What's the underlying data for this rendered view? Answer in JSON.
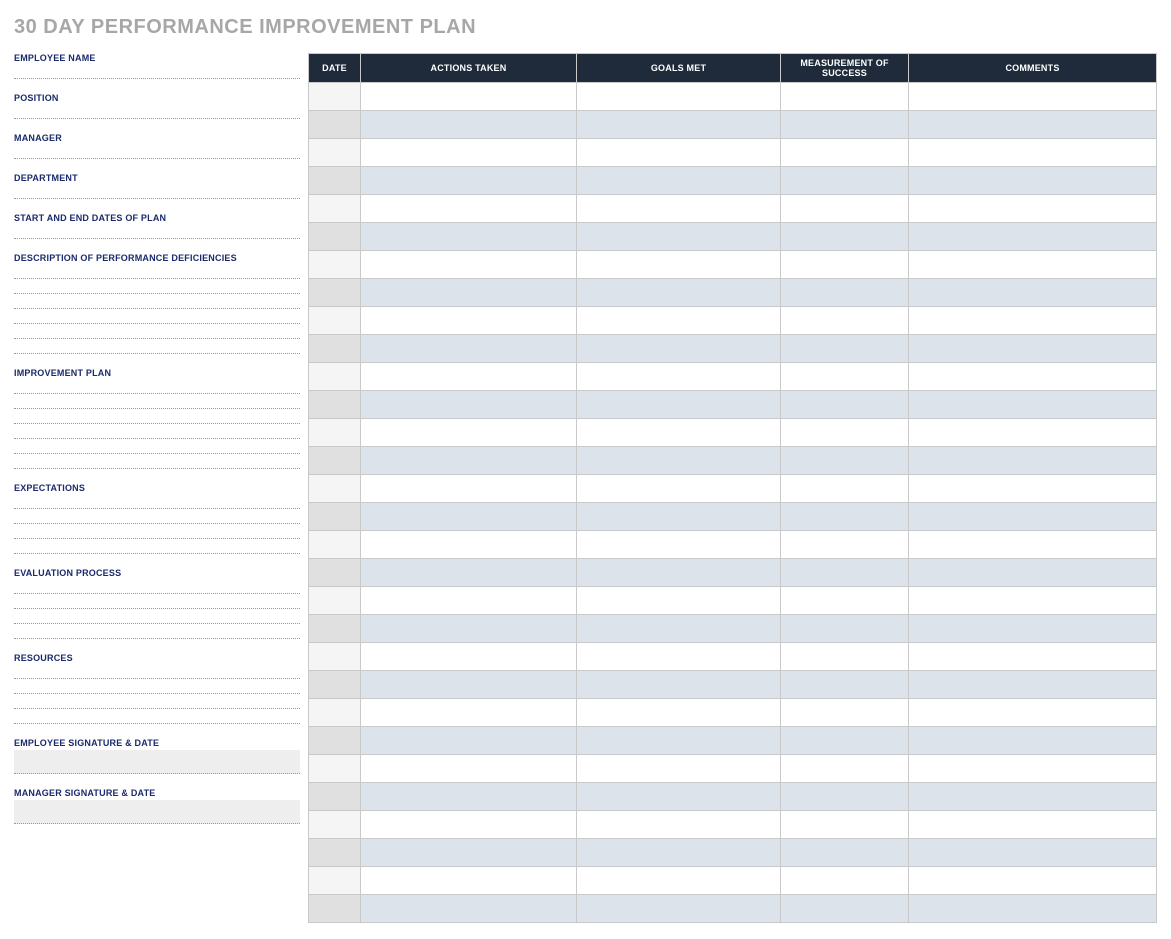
{
  "title": "30 DAY PERFORMANCE IMPROVEMENT PLAN",
  "left": {
    "employee_name": "EMPLOYEE NAME",
    "position": "POSITION",
    "manager": "MANAGER",
    "department": "DEPARTMENT",
    "dates": "START AND END DATES OF PLAN",
    "deficiencies": "DESCRIPTION OF PERFORMANCE DEFICIENCIES",
    "improvement": "IMPROVEMENT PLAN",
    "expectations": "EXPECTATIONS",
    "evaluation": "EVALUATION PROCESS",
    "resources": "RESOURCES",
    "emp_sig": "EMPLOYEE SIGNATURE & DATE",
    "mgr_sig": "MANAGER SIGNATURE & DATE"
  },
  "right": {
    "headers": {
      "date": "DATE",
      "actions": "ACTIONS TAKEN",
      "goals": "GOALS MET",
      "measurement": "MEASUREMENT OF SUCCESS",
      "comments": "COMMENTS"
    },
    "rows": 30
  }
}
